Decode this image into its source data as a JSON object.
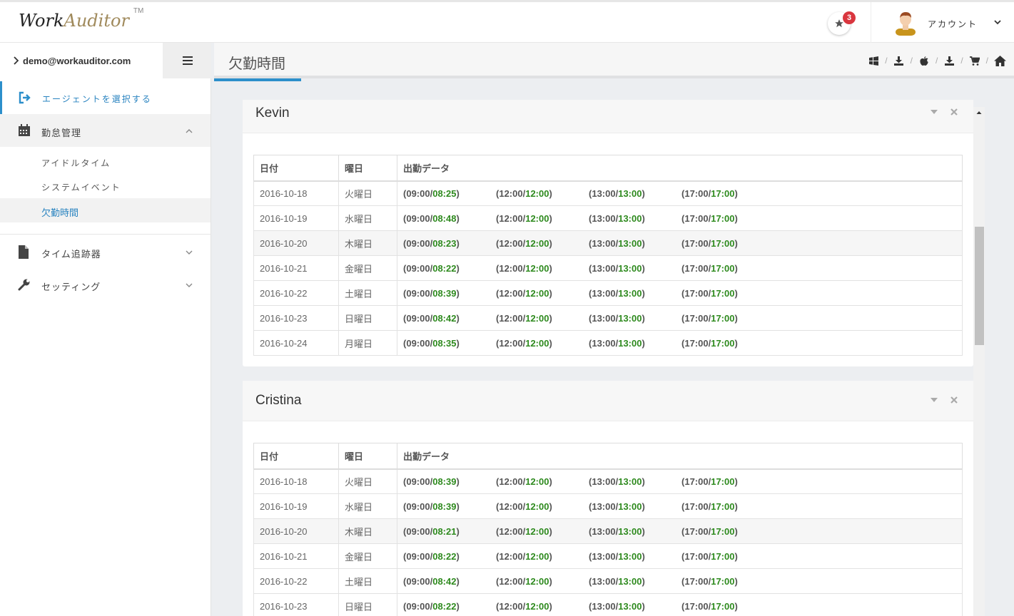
{
  "header": {
    "logo_work": "Work",
    "logo_auditor": "Auditor",
    "logo_tm": "TM",
    "notification_count": "3",
    "account_label": "アカウント"
  },
  "sidebar": {
    "user_email": "demo@workauditor.com",
    "items": [
      {
        "label": "エージェントを選択する",
        "icon": "sign-in-icon",
        "active": true
      },
      {
        "label": "勤怠管理",
        "icon": "calendar-icon",
        "expanded": true
      },
      {
        "label": "タイム追跡器",
        "icon": "file-icon"
      },
      {
        "label": "セッティング",
        "icon": "wrench-icon"
      }
    ],
    "submenu": [
      "アイドルタイム",
      "システムイベント",
      "欠勤時間"
    ],
    "selected_submenu": "欠勤時間"
  },
  "page": {
    "title": "欠勤時間",
    "toolbar_icons": [
      "windows-icon",
      "download-icon",
      "apple-icon",
      "download-icon",
      "cart-icon",
      "home-icon"
    ]
  },
  "table_headers": [
    "日付",
    "曜日",
    "出勤データ"
  ],
  "employees": [
    {
      "name": "Kevin",
      "rows": [
        {
          "date": "2016-10-18",
          "day": "火曜日",
          "p": [
            [
              "09:00",
              "08:25"
            ],
            [
              "12:00",
              "12:00"
            ],
            [
              "13:00",
              "13:00"
            ],
            [
              "17:00",
              "17:00"
            ]
          ]
        },
        {
          "date": "2016-10-19",
          "day": "水曜日",
          "p": [
            [
              "09:00",
              "08:48"
            ],
            [
              "12:00",
              "12:00"
            ],
            [
              "13:00",
              "13:00"
            ],
            [
              "17:00",
              "17:00"
            ]
          ]
        },
        {
          "date": "2016-10-20",
          "day": "木曜日",
          "p": [
            [
              "09:00",
              "08:23"
            ],
            [
              "12:00",
              "12:00"
            ],
            [
              "13:00",
              "13:00"
            ],
            [
              "17:00",
              "17:00"
            ]
          ]
        },
        {
          "date": "2016-10-21",
          "day": "金曜日",
          "p": [
            [
              "09:00",
              "08:22"
            ],
            [
              "12:00",
              "12:00"
            ],
            [
              "13:00",
              "13:00"
            ],
            [
              "17:00",
              "17:00"
            ]
          ]
        },
        {
          "date": "2016-10-22",
          "day": "土曜日",
          "p": [
            [
              "09:00",
              "08:39"
            ],
            [
              "12:00",
              "12:00"
            ],
            [
              "13:00",
              "13:00"
            ],
            [
              "17:00",
              "17:00"
            ]
          ]
        },
        {
          "date": "2016-10-23",
          "day": "日曜日",
          "p": [
            [
              "09:00",
              "08:42"
            ],
            [
              "12:00",
              "12:00"
            ],
            [
              "13:00",
              "13:00"
            ],
            [
              "17:00",
              "17:00"
            ]
          ]
        },
        {
          "date": "2016-10-24",
          "day": "月曜日",
          "p": [
            [
              "09:00",
              "08:35"
            ],
            [
              "12:00",
              "12:00"
            ],
            [
              "13:00",
              "13:00"
            ],
            [
              "17:00",
              "17:00"
            ]
          ]
        }
      ]
    },
    {
      "name": "Cristina",
      "rows": [
        {
          "date": "2016-10-18",
          "day": "火曜日",
          "p": [
            [
              "09:00",
              "08:39"
            ],
            [
              "12:00",
              "12:00"
            ],
            [
              "13:00",
              "13:00"
            ],
            [
              "17:00",
              "17:00"
            ]
          ]
        },
        {
          "date": "2016-10-19",
          "day": "水曜日",
          "p": [
            [
              "09:00",
              "08:39"
            ],
            [
              "12:00",
              "12:00"
            ],
            [
              "13:00",
              "13:00"
            ],
            [
              "17:00",
              "17:00"
            ]
          ]
        },
        {
          "date": "2016-10-20",
          "day": "木曜日",
          "p": [
            [
              "09:00",
              "08:21"
            ],
            [
              "12:00",
              "12:00"
            ],
            [
              "13:00",
              "13:00"
            ],
            [
              "17:00",
              "17:00"
            ]
          ]
        },
        {
          "date": "2016-10-21",
          "day": "金曜日",
          "p": [
            [
              "09:00",
              "08:22"
            ],
            [
              "12:00",
              "12:00"
            ],
            [
              "13:00",
              "13:00"
            ],
            [
              "17:00",
              "17:00"
            ]
          ]
        },
        {
          "date": "2016-10-22",
          "day": "土曜日",
          "p": [
            [
              "09:00",
              "08:42"
            ],
            [
              "12:00",
              "12:00"
            ],
            [
              "13:00",
              "13:00"
            ],
            [
              "17:00",
              "17:00"
            ]
          ]
        },
        {
          "date": "2016-10-23",
          "day": "日曜日",
          "p": [
            [
              "09:00",
              "08:22"
            ],
            [
              "12:00",
              "12:00"
            ],
            [
              "13:00",
              "13:00"
            ],
            [
              "17:00",
              "17:00"
            ]
          ]
        }
      ]
    }
  ],
  "colors": {
    "accent": "#2c8fcb",
    "green": "#2e8a1e",
    "badge": "#d9363e"
  }
}
